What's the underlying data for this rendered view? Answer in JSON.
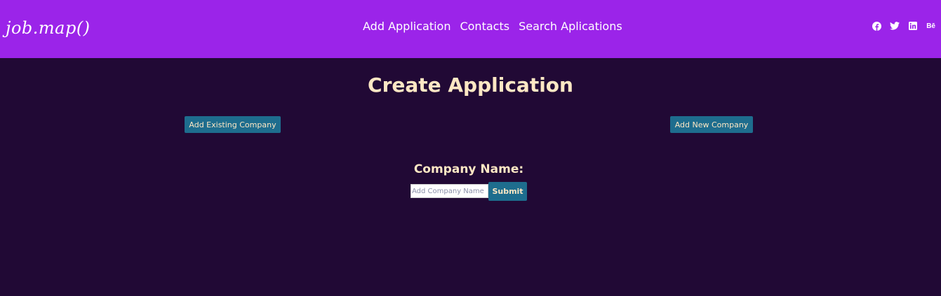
{
  "navbar": {
    "brand": "job.map()",
    "links": [
      "Add Application",
      "Contacts",
      "Search Aplications"
    ],
    "social_icons": [
      "facebook-icon",
      "twitter-icon",
      "linkedin-icon",
      "behance-icon"
    ],
    "behance_label": "Bē",
    "background_color": "#9b24e9"
  },
  "main": {
    "title": "Create Application",
    "add_existing_label": "Add Existing Company",
    "add_new_label": "Add New Company",
    "form": {
      "label": "Company Name:",
      "input_placeholder": "Add Company Name",
      "input_value": "",
      "submit_label": "Submit"
    },
    "background_color": "#210935",
    "accent_color": "#1e6d8e",
    "text_color": "#fde7c4"
  }
}
